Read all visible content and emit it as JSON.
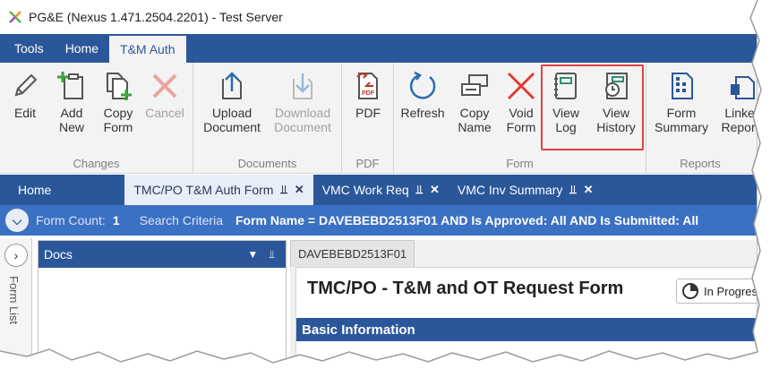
{
  "window": {
    "title": "PG&E (Nexus 1.471.2504.2201) - Test Server"
  },
  "ribbon_tabs": [
    {
      "label": "Tools"
    },
    {
      "label": "Home"
    },
    {
      "label": "T&M Auth"
    }
  ],
  "ribbon": {
    "groups": {
      "changes": "Changes",
      "documents": "Documents",
      "pdf": "PDF",
      "form": "Form",
      "reports": "Reports"
    },
    "buttons": {
      "edit": "Edit",
      "add_new": "Add\nNew",
      "copy_form": "Copy\nForm",
      "cancel": "Cancel",
      "upload_document": "Upload\nDocument",
      "download_document": "Download\nDocument",
      "pdf": "PDF",
      "refresh": "Refresh",
      "copy_name": "Copy\nName",
      "void_form": "Void\nForm",
      "view_log": "View\nLog",
      "view_history": "View\nHistory",
      "form_summary": "Form\nSummary",
      "linked_reports": "Linked\nReports"
    }
  },
  "doc_tabs": [
    {
      "label": "Home"
    },
    {
      "label": "TMC/PO T&M Auth Form"
    },
    {
      "label": "VMC Work Req"
    },
    {
      "label": "VMC Inv Summary"
    }
  ],
  "criteria": {
    "form_count_label": "Form Count:",
    "form_count": "1",
    "search_label": "Search Criteria",
    "search_text": "Form Name = DAVEBEBD2513F01 AND Is Approved: All AND Is Submitted: All"
  },
  "sidebar": {
    "label": "Form List"
  },
  "docs_panel": {
    "title": "Docs"
  },
  "form": {
    "tab": "DAVEBEBD2513F01",
    "title": "TMC/PO - T&M and OT Request Form",
    "status": "In Progress",
    "section": "Basic Information"
  },
  "colors": {
    "ribbon_blue": "#2b579a",
    "criteria_blue": "#3b71c3",
    "highlight_red": "#e04040"
  }
}
